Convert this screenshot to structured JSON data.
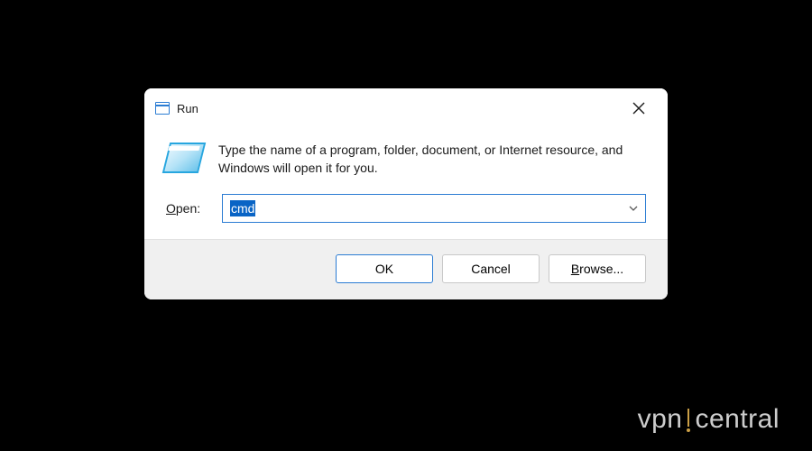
{
  "dialog": {
    "title": "Run",
    "description": "Type the name of a program, folder, document, or Internet resource, and Windows will open it for you.",
    "open_label_pre": "O",
    "open_label_post": "pen:",
    "input_value": "cmd",
    "buttons": {
      "ok": "OK",
      "cancel": "Cancel",
      "browse_pre": "B",
      "browse_post": "rowse..."
    }
  },
  "watermark": {
    "left": "vpn",
    "right": "central"
  }
}
